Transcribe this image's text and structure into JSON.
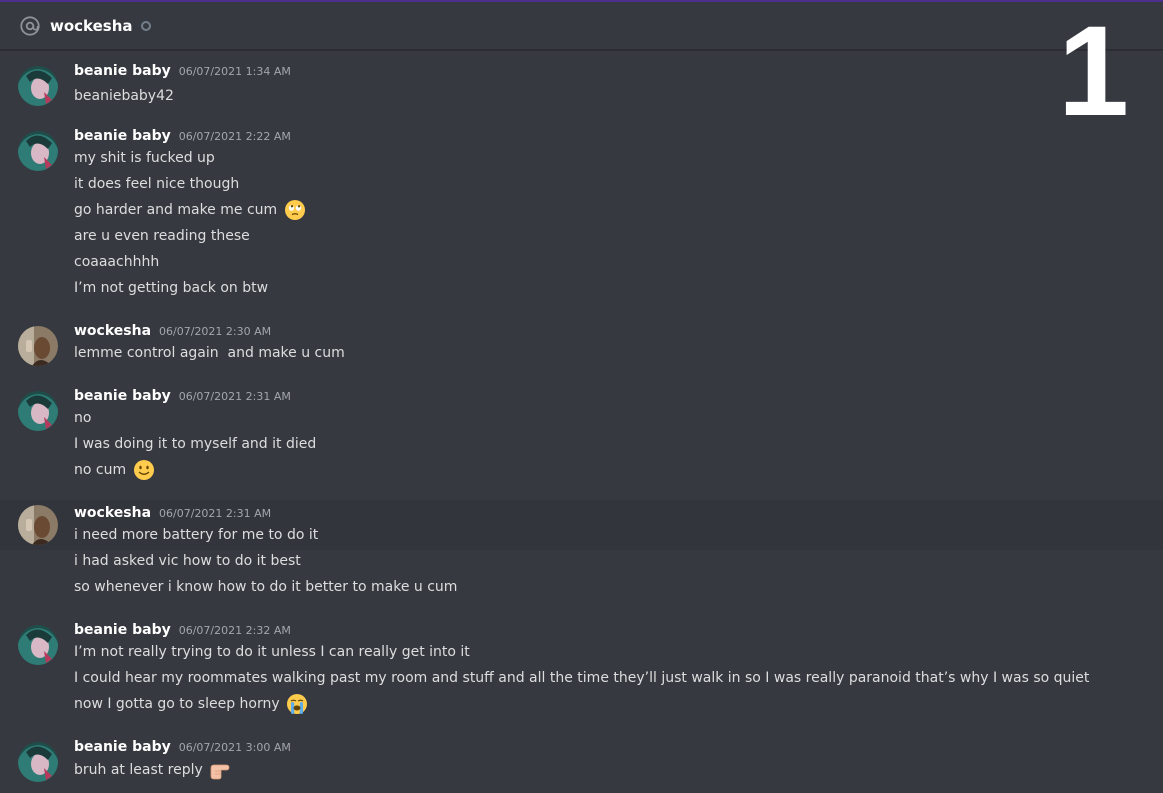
{
  "header": {
    "title": "wockesha",
    "icon": "at-sign-icon",
    "status": "offline"
  },
  "overlay_number": "1",
  "messages": [
    {
      "author": "beanie baby",
      "timestamp": "06/07/2021 1:34 AM",
      "lines": [
        "beaniebaby42"
      ]
    },
    {
      "author": "beanie baby",
      "timestamp": "06/07/2021 2:22 AM",
      "lines": [
        "my shit is fucked up",
        "it does feel nice though",
        "go harder and make me cum",
        "are u even reading these",
        "coaaachhhh",
        "I’m not getting back on btw"
      ],
      "emojis": {
        "2": "face-with-rolling-eyes"
      }
    },
    {
      "author": "wockesha",
      "timestamp": "06/07/2021 2:30 AM",
      "lines": [
        "lemme control again  and make u cum"
      ]
    },
    {
      "author": "beanie baby",
      "timestamp": "06/07/2021 2:31 AM",
      "lines": [
        "no",
        "I was doing it to myself and it died",
        "no cum"
      ],
      "emojis": {
        "2": "slightly-smiling-face"
      }
    },
    {
      "author": "wockesha",
      "timestamp": "06/07/2021 2:31 AM",
      "lines": [
        "i need more battery for me to do it",
        "i had asked vic how to do it best",
        "so whenever i know how to do it better to make u cum"
      ]
    },
    {
      "author": "beanie baby",
      "timestamp": "06/07/2021 2:32 AM",
      "lines": [
        "I’m not really trying to do it unless I can really get into it",
        "I could hear my roommates walking past my room and stuff and all the time they’ll just walk in so I was really paranoid that’s why I was so quiet",
        "now I gotta go to sleep horny"
      ],
      "emojis": {
        "2": "loudly-crying-face"
      }
    },
    {
      "author": "beanie baby",
      "timestamp": "06/07/2021 3:00 AM",
      "lines": [
        "bruh at least reply"
      ],
      "emojis": {
        "0": "backhand-index-pointing-right"
      }
    }
  ]
}
